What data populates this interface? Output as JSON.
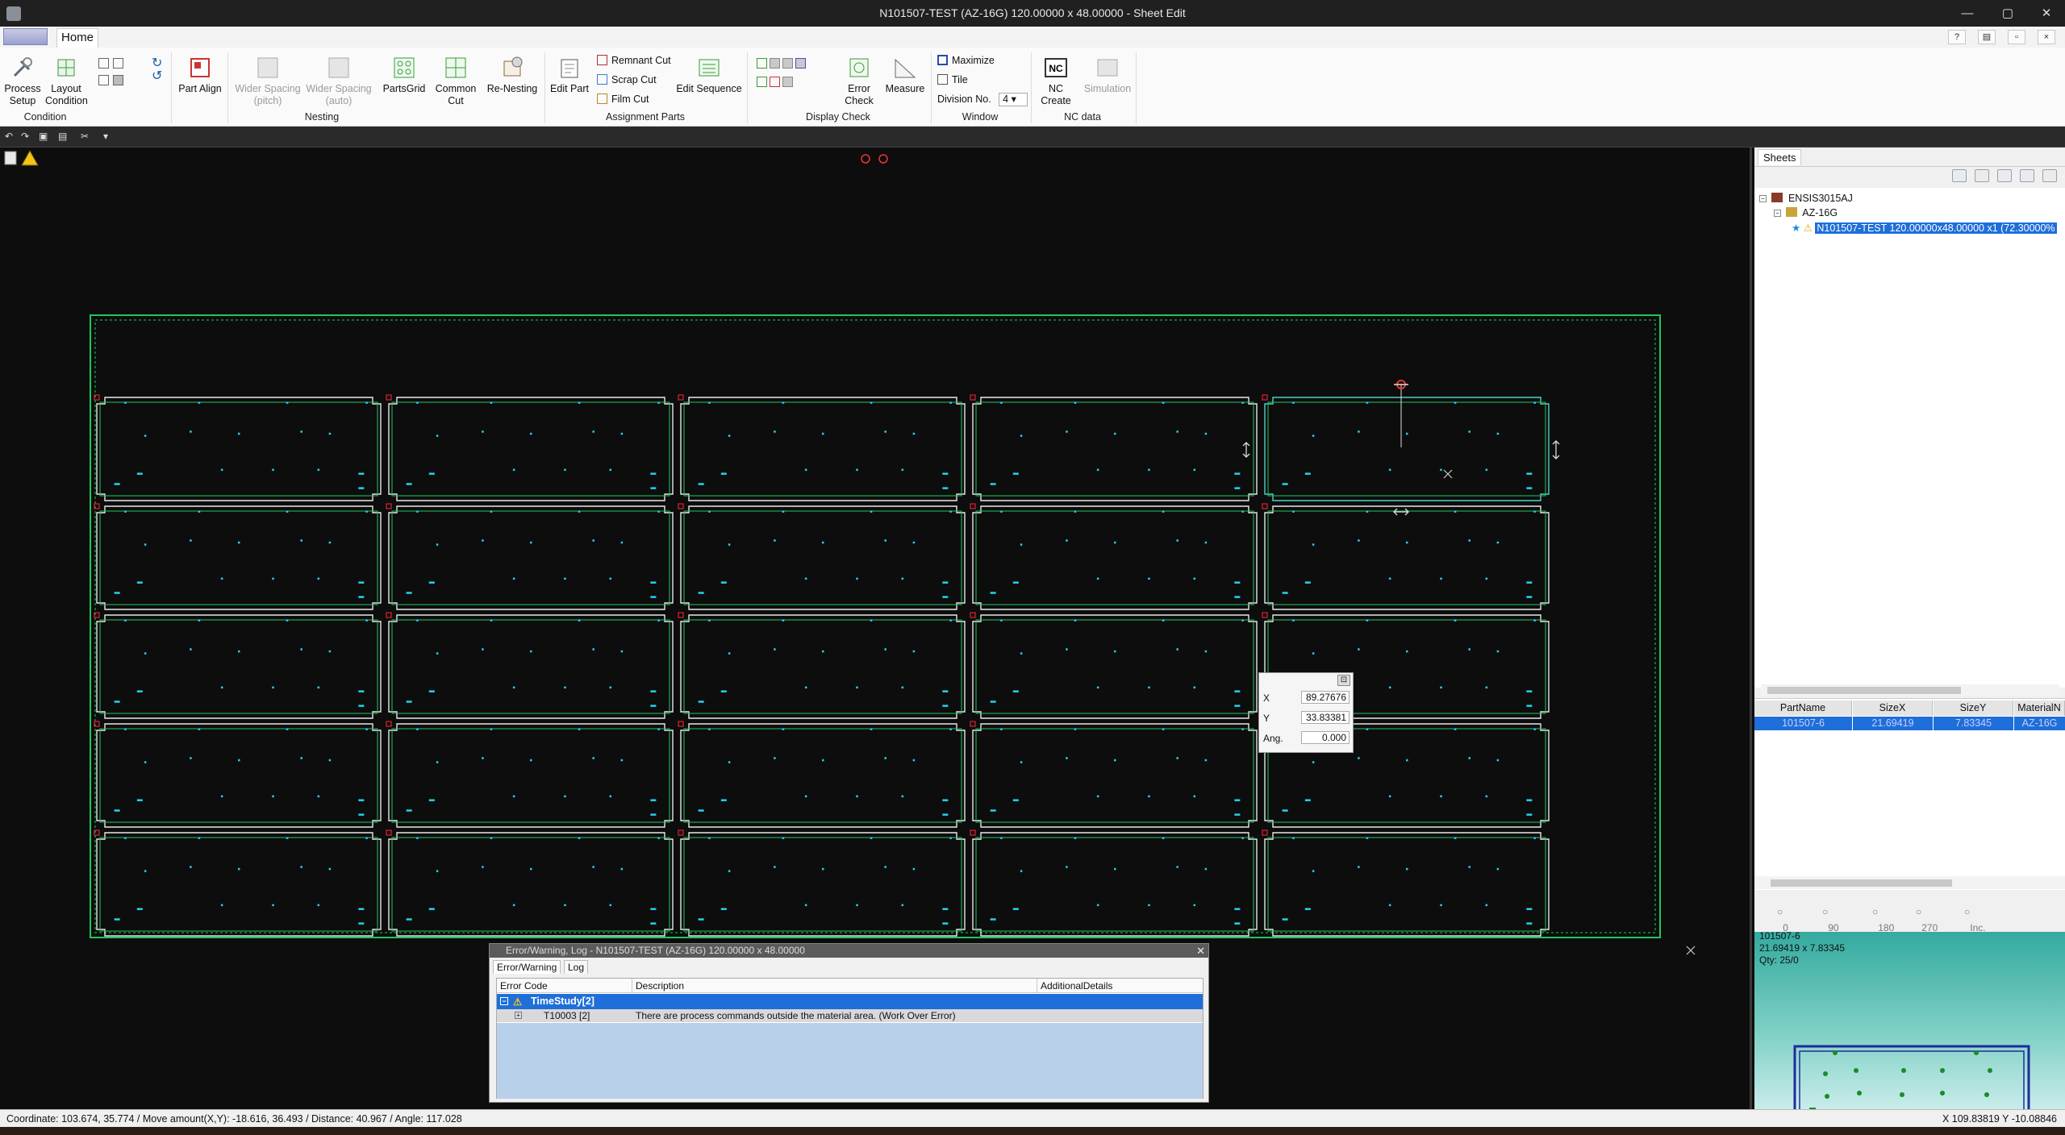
{
  "window": {
    "title": "N101507-TEST (AZ-16G) 120.00000 x 48.00000 - Sheet Edit",
    "controls": [
      "—",
      "▢",
      "✕"
    ]
  },
  "tabs": {
    "home": "Home"
  },
  "ribbon": {
    "process_setup": "Process Setup",
    "process_setup_l1": "Process",
    "process_setup_l2": "Setup",
    "layout_condition_l1": "Layout",
    "layout_condition_l2": "Condition",
    "part_align": "Part Align",
    "wider_spacing_pitch_l1": "Wider Spacing",
    "wider_spacing_pitch_l2": "(pitch)",
    "wider_spacing_auto_l1": "Wider Spacing",
    "wider_spacing_auto_l2": "(auto)",
    "parts_grid": "PartsGrid",
    "common_cut_l1": "Common",
    "common_cut_l2": "Cut",
    "re_nesting": "Re-Nesting",
    "edit_part": "Edit Part",
    "remnant_cut": "Remnant Cut",
    "scrap_cut": "Scrap Cut",
    "film_cut": "Film Cut",
    "edit_sequence": "Edit Sequence",
    "error_check_l1": "Error",
    "error_check_l2": "Check",
    "measure": "Measure",
    "maximize": "Maximize",
    "tile": "Tile",
    "division_no_label": "Division No.",
    "division_no_value": "4",
    "nc_create": "NC Create",
    "simulation": "Simulation",
    "groups": {
      "condition": "Condition",
      "nesting": "Nesting",
      "assignment_parts": "Assignment Parts",
      "display_check": "Display Check",
      "window": "Window",
      "nc_data": "NC data"
    }
  },
  "coord_popup": {
    "x_label": "X",
    "x_value": "89.27676",
    "y_label": "Y",
    "y_value": "33.83381",
    "ang_label": "Ang.",
    "ang_value": "0.000"
  },
  "sidebar": {
    "tab": "Sheets",
    "tree": {
      "root": "ENSIS3015AJ",
      "material": "AZ-16G",
      "sheet": "N101507-TEST  120.00000x48.00000  x1 (72.30000%"
    },
    "parts_table": {
      "columns": [
        "PartName",
        "SizeX",
        "SizeY",
        "MaterialN"
      ],
      "rows": [
        [
          "101507-6",
          "21.69419",
          "7.83345",
          "AZ-16G"
        ]
      ]
    },
    "rotation": [
      "0",
      "90",
      "180",
      "270",
      "Inc."
    ],
    "preview": {
      "name": "101507-6",
      "size": "21.69419 x 7.83345",
      "qty": "Qty: 25/0"
    }
  },
  "error_dialog": {
    "title": "Error/Warning, Log - N101507-TEST (AZ-16G) 120.00000 x 48.00000",
    "tabs": [
      "Error/Warning",
      "Log"
    ],
    "columns": [
      "Error Code",
      "Description",
      "AdditionalDetails"
    ],
    "group_row": "TimeStudy[2]",
    "detail_code": "T10003 [2]",
    "detail_desc": "There are process commands outside the material area. (Work Over Error)"
  },
  "status": {
    "left": "Coordinate: 103.674, 35.774  /  Move amount(X,Y): -18.616, 36.493  /  Distance: 40.967  /  Angle: 117.028",
    "right": "X  109.83819   Y  -10.08846"
  },
  "colors": {
    "part_outline": "#e8e8e8",
    "part_inner": "#22c55e",
    "sheet_border": "#22c55e",
    "hole": "#22d3ee",
    "selection": "#1e6fd9",
    "warning": "#f5c518"
  },
  "nest_grid": {
    "rows": 5,
    "cols": 5
  }
}
